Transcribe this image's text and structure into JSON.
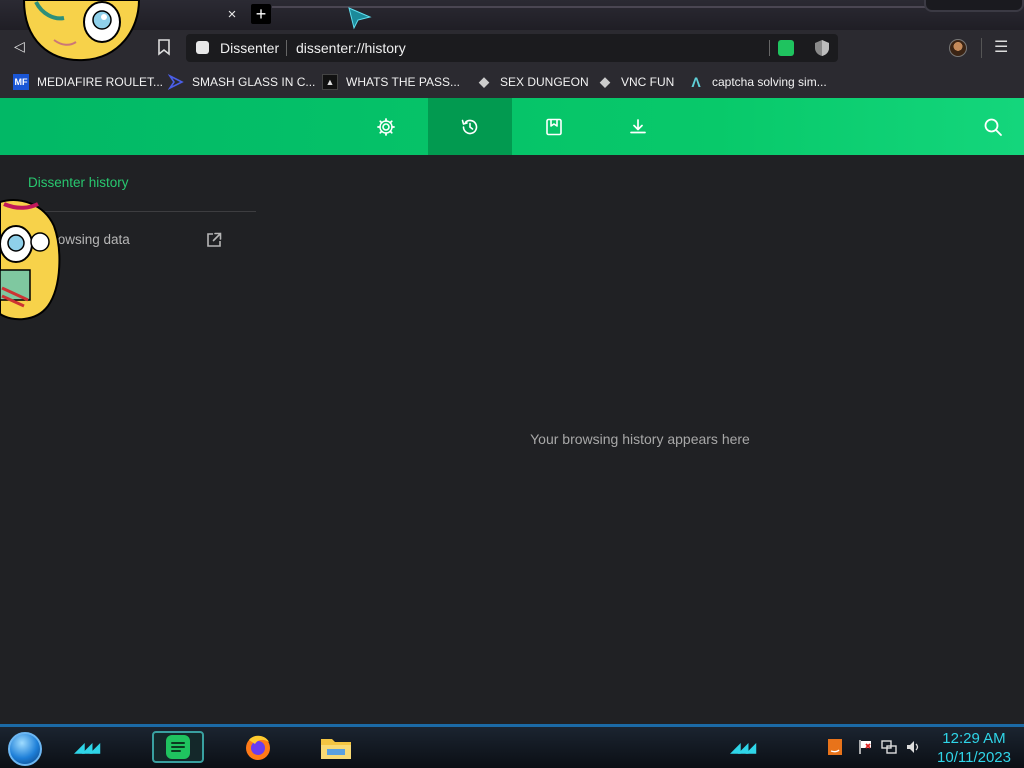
{
  "tabs": {
    "close_glyph": "×",
    "new_glyph": "+"
  },
  "toolbar": {
    "back_glyph": "◁",
    "menu_glyph": "☰",
    "site_name": "Dissenter",
    "url": "dissenter://history"
  },
  "bookmarks": [
    {
      "label": "MEDIAFIRE ROULET...",
      "icon": "mediafire-icon",
      "icon_text": "MF",
      "color": "#1a56d6"
    },
    {
      "label": "SMASH GLASS IN C...",
      "icon": "chevron-icon",
      "icon_text": "",
      "color": "#4a5ee8"
    },
    {
      "label": "WHATS THE PASS...",
      "icon": "terminal-icon",
      "icon_text": "▲",
      "color": "#111111"
    },
    {
      "label": "SEX DUNGEON",
      "icon": "cube-icon",
      "icon_text": "◆",
      "color": "#cccccc"
    },
    {
      "label": "VNC FUN",
      "icon": "cube-icon",
      "icon_text": "◆",
      "color": "#cccccc"
    },
    {
      "label": "captcha solving sim...",
      "icon": "lambda-icon",
      "icon_text": "Λ",
      "color": "#5fd0d8"
    }
  ],
  "header": {
    "buttons": [
      "settings-icon",
      "history-icon",
      "bookmarks-icon",
      "downloads-icon"
    ],
    "active": "history-icon",
    "accent": "#08c96a"
  },
  "sidebar": {
    "title": "Dissenter history",
    "link": "ar browsing data"
  },
  "main": {
    "empty_message": "Your browsing history appears here"
  },
  "taskbar": {
    "time": "12:29 AM",
    "date": "10/11/2023"
  }
}
